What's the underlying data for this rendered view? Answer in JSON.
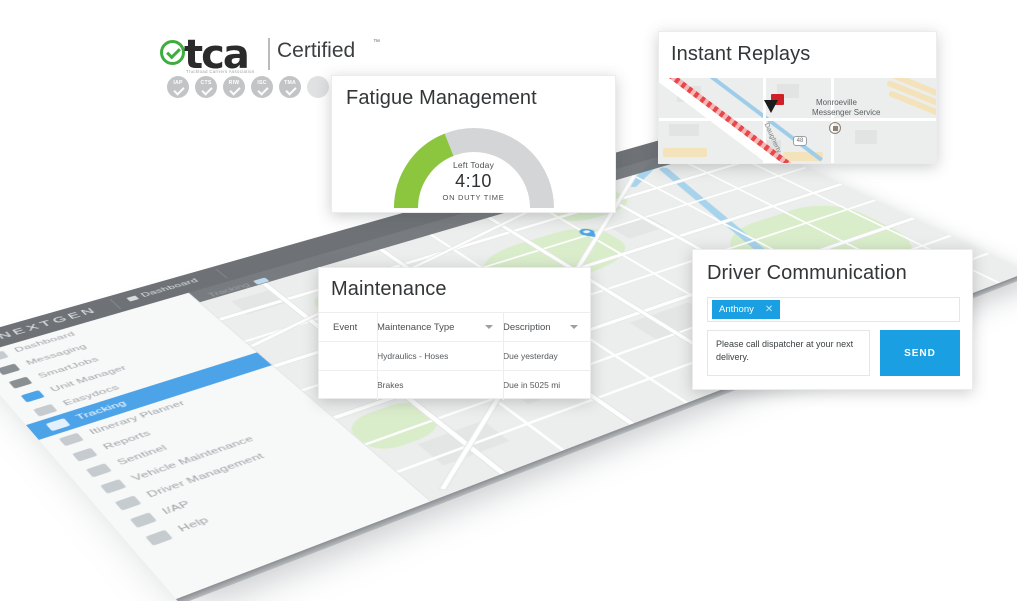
{
  "brand": {
    "logo_check_icon": "check-circle-icon",
    "wordmark": "tca",
    "tagline": "Truckload Carriers Association",
    "certified": "Certified",
    "trademark": "™",
    "badges": [
      {
        "label": "IAP"
      },
      {
        "label": "CTS"
      },
      {
        "label": "RIW"
      },
      {
        "label": "ISC"
      },
      {
        "label": "TMA"
      },
      {
        "label": ""
      }
    ]
  },
  "app": {
    "logo": "NEXTGEN",
    "header_items": [
      {
        "label": "Dashboard",
        "icon": "dashboard-icon"
      }
    ],
    "tab": {
      "label": "Tracking",
      "icon": "tracking-tab-icon"
    },
    "sidebar": [
      {
        "label": "Dashboard",
        "icon": "dashboard-icon",
        "active": false
      },
      {
        "label": "Messaging",
        "icon": "messaging-icon",
        "active": false
      },
      {
        "label": "SmartJobs",
        "icon": "smartjobs-icon",
        "active": false
      },
      {
        "label": "Unit Manager",
        "icon": "unit-manager-icon",
        "active": false
      },
      {
        "label": "Easydocs",
        "icon": "easydocs-icon",
        "active": false
      },
      {
        "label": "Tracking",
        "icon": "tracking-icon",
        "active": true
      },
      {
        "label": "Itinerary Planner",
        "icon": "itinerary-planner-icon",
        "active": false
      },
      {
        "label": "Reports",
        "icon": "reports-icon",
        "active": false
      },
      {
        "label": "Sentinel",
        "icon": "sentinel-icon",
        "active": false
      },
      {
        "label": "Vehicle Maintenance",
        "icon": "vehicle-maintenance-icon",
        "active": false
      },
      {
        "label": "Driver Management",
        "icon": "driver-management-icon",
        "active": false
      },
      {
        "label": "I/AP",
        "icon": "iap-icon",
        "active": false
      },
      {
        "label": "Help",
        "icon": "help-icon",
        "active": false
      }
    ]
  },
  "fatigue": {
    "title": "Fatigue Management",
    "gauge": {
      "caption": "Left Today",
      "value": "4:10",
      "unit": "ON DUTY TIME",
      "percent": 38,
      "fill_color": "#8cc63e",
      "track_color": "#d4d5d6"
    }
  },
  "replays": {
    "title": "Instant Replays",
    "map": {
      "poi_label": "Monroeville\nMessenger Service",
      "poi_line1": "Monroeville",
      "poi_line2": "Messenger Service",
      "street_label": "Daugherty",
      "shield_label": "48",
      "route_color": "#e8474a",
      "vehicle_icon": "vehicle-arrow-icon"
    }
  },
  "maintenance": {
    "title": "Maintenance",
    "columns": [
      "Event",
      "Maintenance Type",
      "Description"
    ],
    "rows": [
      {
        "status": "overdue",
        "status_icon": "clock-alert-icon",
        "type": "Hydraulics - Hoses",
        "description": "Due yesterday"
      },
      {
        "status": "ok",
        "status_icon": "check-circle-icon",
        "type": "Brakes",
        "description": "Due in 5025 mi"
      }
    ],
    "status_colors": {
      "overdue": "#e02020",
      "ok": "#7dc242"
    }
  },
  "driver": {
    "title": "Driver Communication",
    "recipient": {
      "name": "Anthony",
      "remove_icon": "close-icon"
    },
    "message": "Please call dispatcher at your next delivery.",
    "send_label": "SEND",
    "accent_color": "#1aa0e2"
  },
  "map_pins": [
    {
      "id": "pin-1",
      "icon": "map-pin-icon"
    },
    {
      "id": "pin-2",
      "icon": "map-pin-icon"
    },
    {
      "id": "pin-3",
      "icon": "map-pin-icon"
    }
  ]
}
